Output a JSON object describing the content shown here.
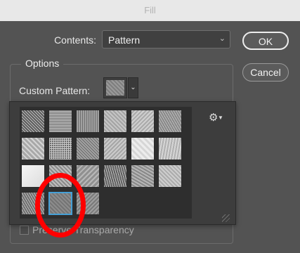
{
  "window": {
    "title": "Fill"
  },
  "contents": {
    "label": "Contents:",
    "value": "Pattern"
  },
  "buttons": {
    "ok": "OK",
    "cancel": "Cancel"
  },
  "options": {
    "title": "Options",
    "custom_pattern_label": "Custom Pattern:",
    "preserve_label": "Preserve Transparency"
  },
  "colors": {
    "dialog_bg": "#535353",
    "picker_bg": "#3d3d3d",
    "selection_border": "#46a0d6",
    "annotation": "#ff0000"
  },
  "pattern_picker": {
    "selected_index": 19,
    "patterns": [
      {
        "name": "pattern-1",
        "bg": "#8c8c8c",
        "tex": "repeating-linear-gradient(45deg,#bdbdbd 0 1px,#5a5a5a 1px 3px)"
      },
      {
        "name": "pattern-2",
        "bg": "#9a9a9a",
        "tex": "repeating-linear-gradient(0deg,#a8a8a8 0 2px,#8f8f8f 2px 4px)"
      },
      {
        "name": "pattern-3",
        "bg": "#8a8a8a",
        "tex": "repeating-linear-gradient(90deg,#a0a0a0 0 2px,#6f6f6f 2px 3px)"
      },
      {
        "name": "pattern-4",
        "bg": "#b2b2b2",
        "tex": "repeating-linear-gradient(45deg,#c6c6c6 0 2px,#a4a4a4 2px 4px)"
      },
      {
        "name": "pattern-5",
        "bg": "#bdbdbd",
        "tex": "repeating-linear-gradient(135deg,#d0d0d0 0 2px,#aaaaaa 2px 4px)"
      },
      {
        "name": "pattern-6",
        "bg": "#a2a2a2",
        "tex": "repeating-linear-gradient(60deg,#bcbcbc 0 1px,#888888 1px 3px)"
      },
      {
        "name": "pattern-7",
        "bg": "#bcbcbc",
        "tex": "repeating-linear-gradient(45deg,#d4d4d4 0 2px,#a8a8a8 2px 5px)"
      },
      {
        "name": "pattern-8",
        "bg": "#7d7d7d",
        "tex": "repeating-linear-gradient(0deg,#c8c8c8 0 1px,transparent 1px 3px),repeating-linear-gradient(90deg,#c8c8c8 0 1px,#6a6a6a 1px 3px)"
      },
      {
        "name": "pattern-9",
        "bg": "#9a9a9a",
        "tex": "repeating-linear-gradient(45deg,#b4b4b4 0 1px,#7c7c7c 1px 3px)"
      },
      {
        "name": "pattern-10",
        "bg": "#b8b8b8",
        "tex": "repeating-linear-gradient(135deg,#cccccc 0 2px,#a6a6a6 2px 4px)"
      },
      {
        "name": "pattern-11",
        "bg": "#e2e2e2",
        "tex": "repeating-linear-gradient(45deg,#ececec 0 3px,#d6d6d6 3px 6px)"
      },
      {
        "name": "pattern-12",
        "bg": "#c4c4c4",
        "tex": "repeating-linear-gradient(100deg,#d6d6d6 0 2px,#b0b0b0 2px 4px)"
      },
      {
        "name": "pattern-13",
        "bg": "#eeeeee",
        "tex": "linear-gradient(135deg,#f6f6f6,#dcdcdc)"
      },
      {
        "name": "pattern-14",
        "bg": "#9f9f9f",
        "tex": "repeating-linear-gradient(45deg,#bdbdbd 0 2px,#8a8a8a 2px 4px)"
      },
      {
        "name": "pattern-15",
        "bg": "#a4a4a4",
        "tex": "repeating-linear-gradient(135deg,#b8b8b8 0 2px,#909090 2px 5px)"
      },
      {
        "name": "pattern-16",
        "bg": "#7a7a7a",
        "tex": "repeating-linear-gradient(75deg,#c0c0c0 0 1px,#5e5e5e 1px 3px)"
      },
      {
        "name": "pattern-17",
        "bg": "#9c9c9c",
        "tex": "repeating-linear-gradient(30deg,#b6b6b6 0 2px,#888888 2px 4px)"
      },
      {
        "name": "pattern-18",
        "bg": "#bebebe",
        "tex": "repeating-linear-gradient(45deg,#cecece 0 2px,#acacac 2px 4px)"
      },
      {
        "name": "pattern-19",
        "bg": "#8e8e8e",
        "tex": "repeating-linear-gradient(60deg,#bababa 0 1px,#6e6e6e 1px 3px)"
      },
      {
        "name": "pattern-20",
        "bg": "#7f7f7f",
        "tex": "repeating-linear-gradient(45deg,#8c8c8c 0 2px,#747474 2px 4px)"
      },
      {
        "name": "pattern-21",
        "bg": "#8a8a8a",
        "tex": "repeating-linear-gradient(135deg,#9e9e9e 0 2px,#7a7a7a 2px 4px)"
      }
    ]
  }
}
